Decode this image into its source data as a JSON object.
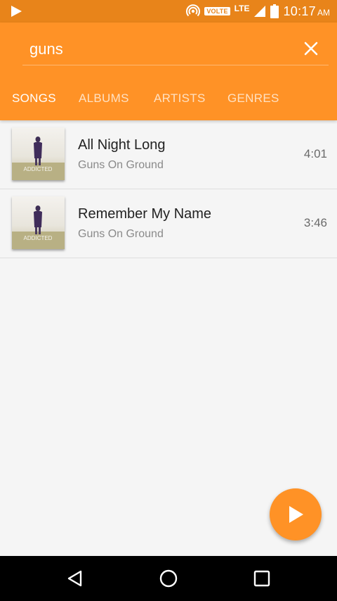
{
  "status_bar": {
    "network": "LTE",
    "volte": "VOLTE",
    "time": "10:17",
    "ampm": "AM"
  },
  "search": {
    "value": "guns",
    "placeholder": ""
  },
  "tabs": [
    {
      "label": "SONGS",
      "active": true
    },
    {
      "label": "ALBUMS",
      "active": false
    },
    {
      "label": "ARTISTS",
      "active": false
    },
    {
      "label": "GENRES",
      "active": false
    }
  ],
  "songs": [
    {
      "title": "All Night Long",
      "artist": "Guns On Ground",
      "duration": "4:01",
      "art_text": "ADDICTED"
    },
    {
      "title": "Remember My Name",
      "artist": "Guns On Ground",
      "duration": "3:46",
      "art_text": "ADDICTED"
    }
  ],
  "icons": {
    "close": "close-icon",
    "fab": "play-icon",
    "nav": [
      "back-icon",
      "home-icon",
      "recents-icon"
    ]
  },
  "colors": {
    "status_bar": "#e8841a",
    "accent": "#ff9226",
    "background": "#f5f5f5"
  }
}
